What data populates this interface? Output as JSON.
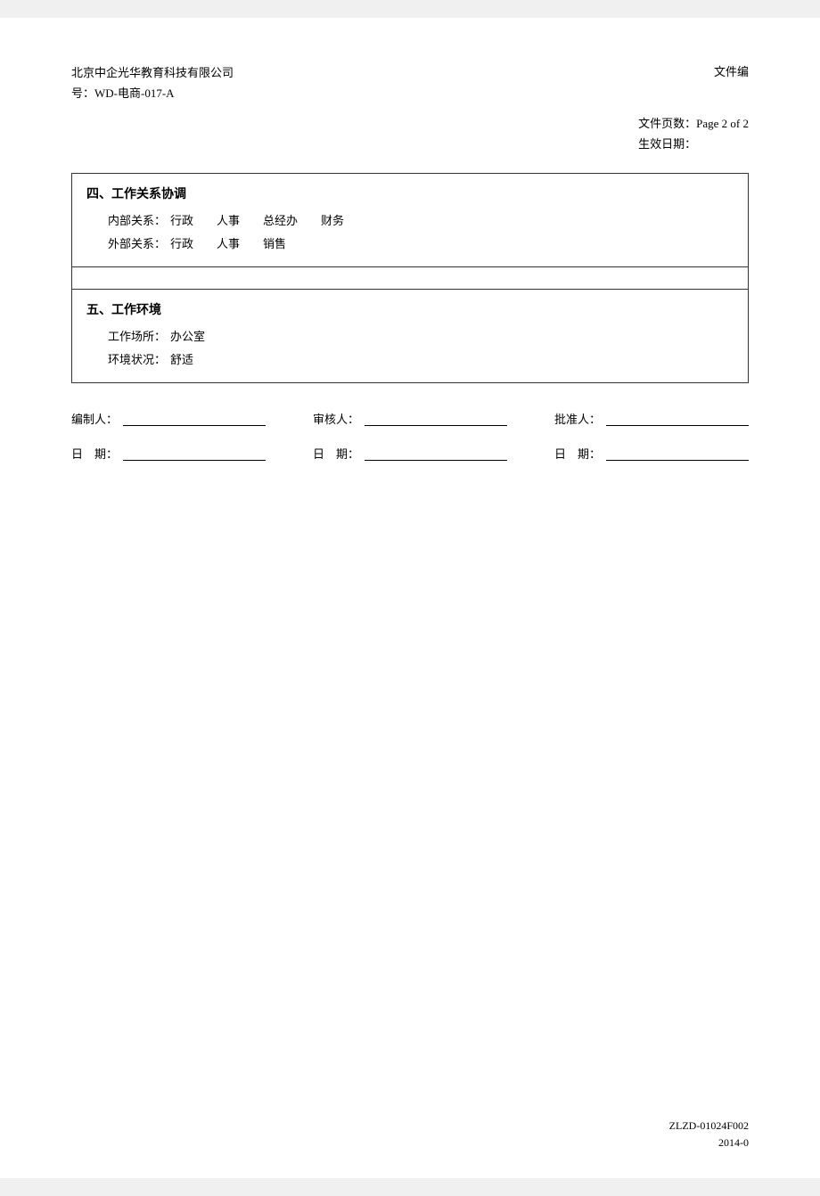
{
  "header": {
    "company_line1": "北京中企光华教育科技有限公司",
    "company_line2": "号：WD-电商-017-A",
    "doc_label": "文件编"
  },
  "meta": {
    "page_label": "文件页数：",
    "page_value": "Page 2 of 2",
    "effective_label": "生效日期：",
    "effective_value": ""
  },
  "sections": [
    {
      "id": "section4",
      "title": "四、工作关系协调",
      "rows": [
        {
          "label": "内部关系：",
          "value": "行政   人事   总经办   财务"
        },
        {
          "label": "外部关系：",
          "value": "行政   人事   销售"
        }
      ]
    },
    {
      "id": "section5",
      "title": "五、工作环境",
      "rows": [
        {
          "label": "工作场所：",
          "value": "办公室"
        },
        {
          "label": "环境状况：",
          "value": "舒适"
        }
      ]
    }
  ],
  "signatures": {
    "row1": [
      {
        "label": "编制人：",
        "value": ""
      },
      {
        "label": "审核人：",
        "value": ""
      },
      {
        "label": "批准人：",
        "value": ""
      }
    ],
    "row2": [
      {
        "label": "日  期：",
        "value": ""
      },
      {
        "label": "日  期：",
        "value": ""
      },
      {
        "label": "日  期：",
        "value": ""
      }
    ]
  },
  "footer": {
    "ref_line1": "ZLZD-01024F002",
    "ref_line2": "2014-0"
  }
}
